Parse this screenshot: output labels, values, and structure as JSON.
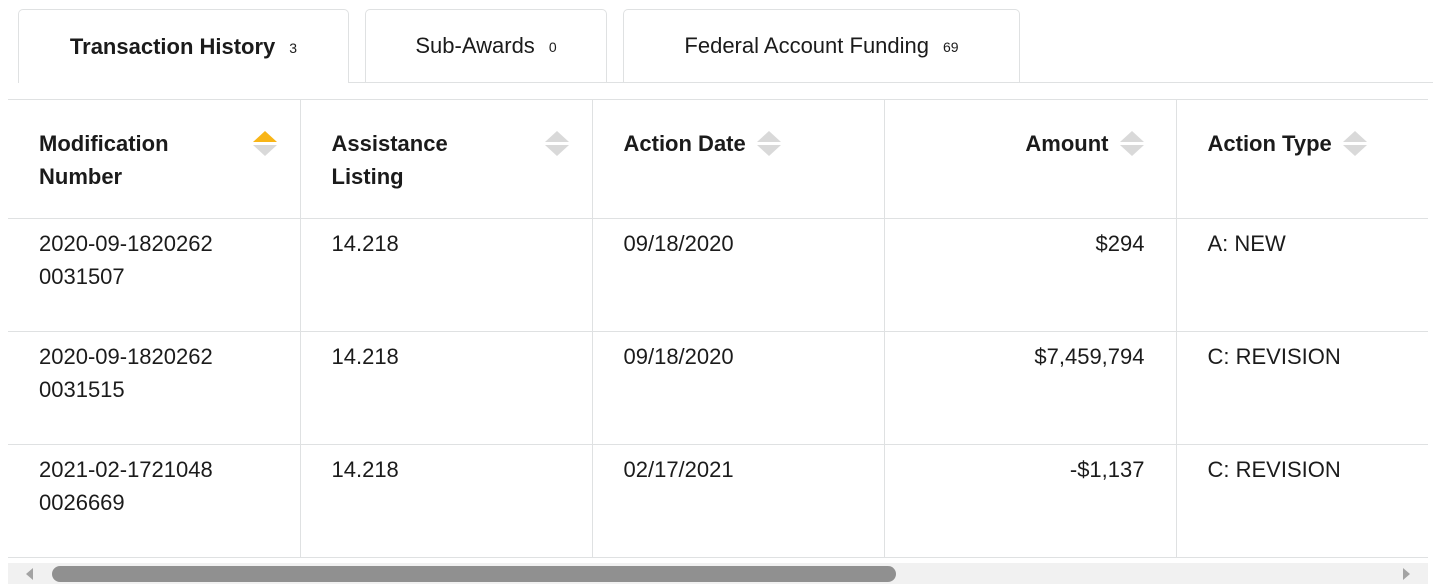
{
  "tabs": [
    {
      "label": "Transaction History",
      "count": "3",
      "active": true
    },
    {
      "label": "Sub-Awards",
      "count": "0",
      "active": false
    },
    {
      "label": "Federal Account Funding",
      "count": "69",
      "active": false
    }
  ],
  "table": {
    "columns": [
      {
        "label": "Modification Number",
        "sort": "ascending"
      },
      {
        "label": "Assistance Listing",
        "sort": "none"
      },
      {
        "label": "Action Date",
        "sort": "none"
      },
      {
        "label": "Amount",
        "sort": "none"
      },
      {
        "label": "Action Type",
        "sort": "none"
      }
    ],
    "rows": [
      {
        "modification_number": "2020-09-18202620031507",
        "assistance_listing": "14.218",
        "action_date": "09/18/2020",
        "amount": "$294",
        "action_type": "A: NEW"
      },
      {
        "modification_number": "2020-09-18202620031515",
        "assistance_listing": "14.218",
        "action_date": "09/18/2020",
        "amount": "$7,459,794",
        "action_type": "C: REVISION"
      },
      {
        "modification_number": "2021-02-17210480026669",
        "assistance_listing": "14.218",
        "action_date": "02/17/2021",
        "amount": "-$1,137",
        "action_type": "C: REVISION"
      }
    ]
  },
  "colors": {
    "sort_active": "#f8b517",
    "sort_inactive": "#d9d9d9",
    "border": "#dfe1e2",
    "scrollbar_thumb": "#909090"
  },
  "icons": {
    "sort": "sort-icon",
    "scroll_left": "arrow-left-icon",
    "scroll_right": "arrow-right-icon"
  }
}
